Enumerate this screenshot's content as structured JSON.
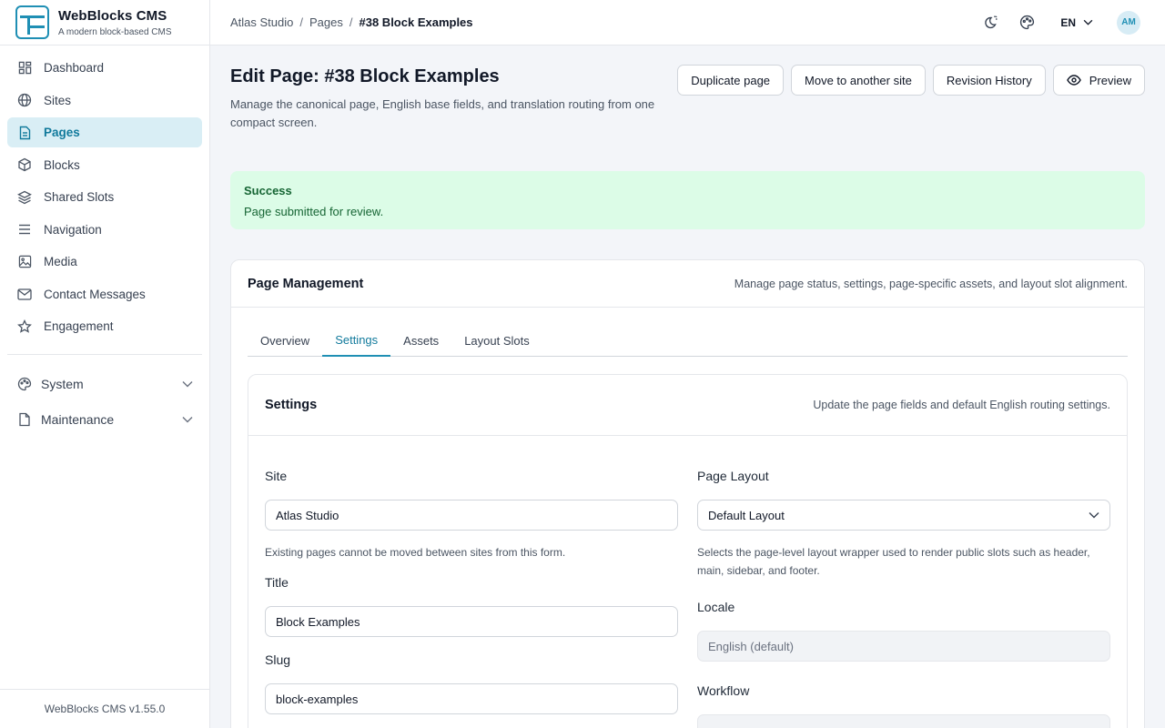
{
  "brand": {
    "name": "WebBlocks CMS",
    "tagline": "A modern block-based CMS"
  },
  "sidebar": {
    "items": [
      {
        "label": "Dashboard",
        "icon": "dashboard-icon"
      },
      {
        "label": "Sites",
        "icon": "globe-icon"
      },
      {
        "label": "Pages",
        "icon": "document-icon",
        "active": true
      },
      {
        "label": "Blocks",
        "icon": "cube-icon"
      },
      {
        "label": "Shared Slots",
        "icon": "layers-icon"
      },
      {
        "label": "Navigation",
        "icon": "menu-icon"
      },
      {
        "label": "Media",
        "icon": "image-icon"
      },
      {
        "label": "Contact Messages",
        "icon": "mail-icon"
      },
      {
        "label": "Engagement",
        "icon": "star-icon"
      }
    ],
    "groups": [
      {
        "label": "System",
        "icon": "palette-icon"
      },
      {
        "label": "Maintenance",
        "icon": "file-icon"
      }
    ],
    "footer": "WebBlocks CMS v1.55.0"
  },
  "topbar": {
    "breadcrumb": [
      "Atlas Studio",
      "Pages",
      "#38 Block Examples"
    ],
    "language": "EN",
    "avatar_initials": "AM"
  },
  "page": {
    "title": "Edit Page: #38 Block Examples",
    "description": "Manage the canonical page, English base fields, and translation routing from one compact screen.",
    "buttons": {
      "duplicate": "Duplicate page",
      "move": "Move to another site",
      "revisions": "Revision History",
      "preview": "Preview"
    }
  },
  "alert": {
    "title": "Success",
    "message": "Page submitted for review."
  },
  "management": {
    "title": "Page Management",
    "subtitle": "Manage page status, settings, page-specific assets, and layout slot alignment.",
    "tabs": [
      "Overview",
      "Settings",
      "Assets",
      "Layout Slots"
    ],
    "active_tab": "Settings"
  },
  "settings": {
    "title": "Settings",
    "subtitle": "Update the page fields and default English routing settings.",
    "site_label": "Site",
    "site_value": "Atlas Studio",
    "site_help": "Existing pages cannot be moved between sites from this form.",
    "title_label": "Title",
    "title_value": "Block Examples",
    "slug_label": "Slug",
    "slug_value": "block-examples",
    "layout_label": "Page Layout",
    "layout_value": "Default Layout",
    "layout_help": "Selects the page-level layout wrapper used to render public slots such as header, main, sidebar, and footer.",
    "locale_label": "Locale",
    "locale_value": "English (default)",
    "workflow_label": "Workflow"
  },
  "colors": {
    "accent": "#1f8fb4",
    "active_bg": "#d9eef5",
    "success_bg": "#dcfce7",
    "success_text": "#166534"
  }
}
